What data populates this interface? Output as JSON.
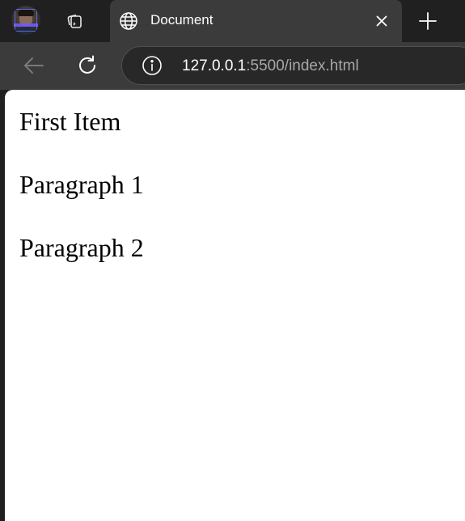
{
  "browser": {
    "tab": {
      "title": "Document",
      "favicon": "globe-icon"
    },
    "tab_actions_icon": "tab-actions-icon",
    "new_tab_icon": "plus-icon",
    "close_tab_icon": "close-icon",
    "toolbar": {
      "back_icon": "back-arrow-icon",
      "refresh_icon": "refresh-icon",
      "info_icon": "info-icon",
      "url_host": "127.0.0.1",
      "url_rest": ":5500/index.html"
    },
    "colors": {
      "frame": "#202020",
      "toolbar": "#3b3b3b",
      "omnibox": "#282828",
      "page": "#ffffff"
    }
  },
  "page": {
    "items": [
      "First Item",
      "Paragraph 1",
      "Paragraph 2"
    ]
  }
}
